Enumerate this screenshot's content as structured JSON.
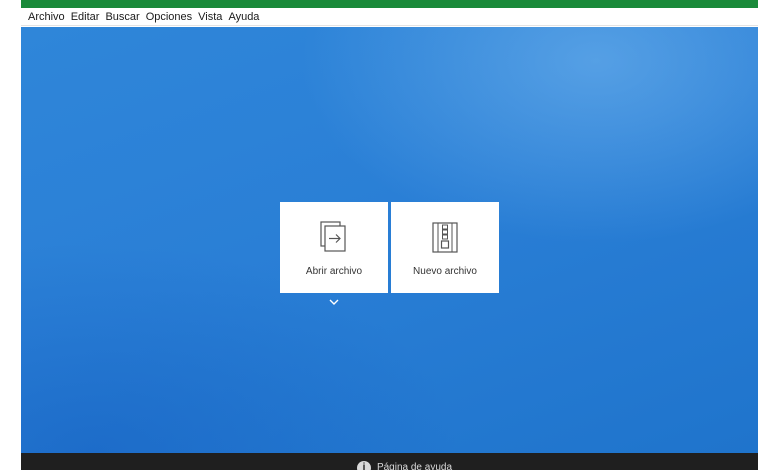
{
  "menu": {
    "items": [
      {
        "label": "Archivo"
      },
      {
        "label": "Editar"
      },
      {
        "label": "Buscar"
      },
      {
        "label": "Opciones"
      },
      {
        "label": "Vista"
      },
      {
        "label": "Ayuda"
      }
    ]
  },
  "tiles": {
    "open": {
      "label": "Abrir archivo",
      "icon": "open-file-icon"
    },
    "new": {
      "label": "Nuevo archivo",
      "icon": "new-archive-icon"
    }
  },
  "footer": {
    "help_label": "Página de ayuda",
    "help_icon": "info-icon"
  },
  "colors": {
    "title_bar": "#1a8a3a",
    "background": "#2a7fd6",
    "footer": "#1f1f1f"
  }
}
